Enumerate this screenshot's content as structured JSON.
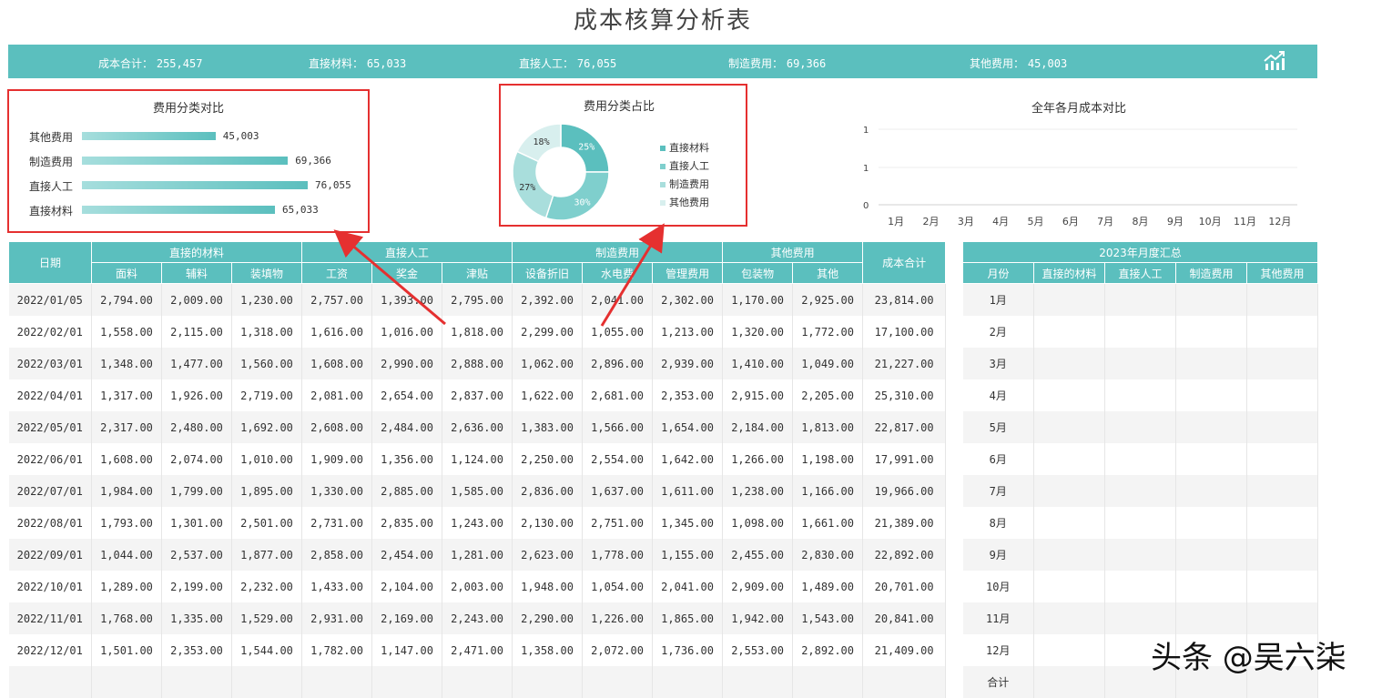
{
  "title": "成本核算分析表",
  "summary": [
    {
      "label": "成本合计：",
      "value": "255,457"
    },
    {
      "label": "直接材料：",
      "value": "65,033"
    },
    {
      "label": "直接人工：",
      "value": "76,055"
    },
    {
      "label": "制造费用：",
      "value": "69,366"
    },
    {
      "label": "其他费用：",
      "value": "45,003"
    }
  ],
  "accent_color": "#5bbfbe",
  "highlight_color": "#e53030",
  "bar_panel": {
    "title": "费用分类对比",
    "chart_data": {
      "type": "bar",
      "orientation": "horizontal",
      "categories": [
        "其他费用",
        "制造费用",
        "直接人工",
        "直接材料"
      ],
      "values": [
        45003,
        69366,
        76055,
        65033
      ],
      "value_labels": [
        "45,003",
        "69,366",
        "76,055",
        "65,033"
      ]
    }
  },
  "pie_panel": {
    "title": "费用分类占比",
    "chart_data": {
      "type": "pie",
      "donut": true,
      "categories": [
        "直接材料",
        "直接人工",
        "制造费用",
        "其他费用"
      ],
      "values": [
        25,
        30,
        27,
        18
      ],
      "value_labels": [
        "25%",
        "30%",
        "27%",
        "18%"
      ],
      "colors": [
        "#5bbfbe",
        "#7fcfcd",
        "#a9dedc",
        "#d8efee"
      ]
    }
  },
  "line_panel": {
    "title": "全年各月成本对比",
    "chart_data": {
      "type": "line",
      "categories": [
        "1月",
        "2月",
        "3月",
        "4月",
        "5月",
        "6月",
        "7月",
        "8月",
        "9月",
        "10月",
        "11月",
        "12月"
      ],
      "y_tick_labels": [
        "1",
        "1",
        "0"
      ],
      "series": [],
      "grid": true
    }
  },
  "main_table": {
    "date_header": "日期",
    "groups": [
      {
        "label": "直接的材料",
        "cols": [
          "面料",
          "辅料",
          "装填物"
        ]
      },
      {
        "label": "直接人工",
        "cols": [
          "工资",
          "奖金",
          "津贴"
        ]
      },
      {
        "label": "制造费用",
        "cols": [
          "设备折旧",
          "水电费",
          "管理费用"
        ]
      },
      {
        "label": "其他费用",
        "cols": [
          "包装物",
          "其他"
        ]
      }
    ],
    "total_header": "成本合计",
    "rows": [
      [
        "2022/01/05",
        "2,794.00",
        "2,009.00",
        "1,230.00",
        "2,757.00",
        "1,393.00",
        "2,795.00",
        "2,392.00",
        "2,041.00",
        "2,302.00",
        "1,170.00",
        "2,925.00",
        "23,814.00"
      ],
      [
        "2022/02/01",
        "1,558.00",
        "2,115.00",
        "1,318.00",
        "1,616.00",
        "1,016.00",
        "1,818.00",
        "2,299.00",
        "1,055.00",
        "1,213.00",
        "1,320.00",
        "1,772.00",
        "17,100.00"
      ],
      [
        "2022/03/01",
        "1,348.00",
        "1,477.00",
        "1,560.00",
        "1,608.00",
        "2,990.00",
        "2,888.00",
        "1,062.00",
        "2,896.00",
        "2,939.00",
        "1,410.00",
        "1,049.00",
        "21,227.00"
      ],
      [
        "2022/04/01",
        "1,317.00",
        "1,926.00",
        "2,719.00",
        "2,081.00",
        "2,654.00",
        "2,837.00",
        "1,622.00",
        "2,681.00",
        "2,353.00",
        "2,915.00",
        "2,205.00",
        "25,310.00"
      ],
      [
        "2022/05/01",
        "2,317.00",
        "2,480.00",
        "1,692.00",
        "2,608.00",
        "2,484.00",
        "2,636.00",
        "1,383.00",
        "1,566.00",
        "1,654.00",
        "2,184.00",
        "1,813.00",
        "22,817.00"
      ],
      [
        "2022/06/01",
        "1,608.00",
        "2,074.00",
        "1,010.00",
        "1,909.00",
        "1,356.00",
        "1,124.00",
        "2,250.00",
        "2,554.00",
        "1,642.00",
        "1,266.00",
        "1,198.00",
        "17,991.00"
      ],
      [
        "2022/07/01",
        "1,984.00",
        "1,799.00",
        "1,895.00",
        "1,330.00",
        "2,885.00",
        "1,585.00",
        "2,836.00",
        "1,637.00",
        "1,611.00",
        "1,238.00",
        "1,166.00",
        "19,966.00"
      ],
      [
        "2022/08/01",
        "1,793.00",
        "1,301.00",
        "2,501.00",
        "2,731.00",
        "2,835.00",
        "1,243.00",
        "2,130.00",
        "2,751.00",
        "1,345.00",
        "1,098.00",
        "1,661.00",
        "21,389.00"
      ],
      [
        "2022/09/01",
        "1,044.00",
        "2,537.00",
        "1,877.00",
        "2,858.00",
        "2,454.00",
        "1,281.00",
        "2,623.00",
        "1,778.00",
        "1,155.00",
        "2,455.00",
        "2,830.00",
        "22,892.00"
      ],
      [
        "2022/10/01",
        "1,289.00",
        "2,199.00",
        "2,232.00",
        "1,433.00",
        "2,104.00",
        "2,003.00",
        "1,948.00",
        "1,054.00",
        "2,041.00",
        "2,909.00",
        "1,489.00",
        "20,701.00"
      ],
      [
        "2022/11/01",
        "1,768.00",
        "1,335.00",
        "1,529.00",
        "2,931.00",
        "2,169.00",
        "2,243.00",
        "2,290.00",
        "1,226.00",
        "1,865.00",
        "1,942.00",
        "1,543.00",
        "20,841.00"
      ],
      [
        "2022/12/01",
        "1,501.00",
        "2,353.00",
        "1,544.00",
        "1,782.00",
        "1,147.00",
        "2,471.00",
        "1,358.00",
        "2,072.00",
        "1,736.00",
        "2,553.00",
        "2,892.00",
        "21,409.00"
      ],
      [
        "",
        "",
        "",
        "",
        "",
        "",
        "",
        "",
        "",
        "",
        "",
        "",
        ""
      ]
    ]
  },
  "summary_table": {
    "title": "2023年月度汇总",
    "headers": [
      "月份",
      "直接的材料",
      "直接人工",
      "制造费用",
      "其他费用"
    ],
    "months": [
      "1月",
      "2月",
      "3月",
      "4月",
      "5月",
      "6月",
      "7月",
      "8月",
      "9月",
      "10月",
      "11月",
      "12月",
      "合计"
    ]
  },
  "watermark": "头条 @吴六柒"
}
